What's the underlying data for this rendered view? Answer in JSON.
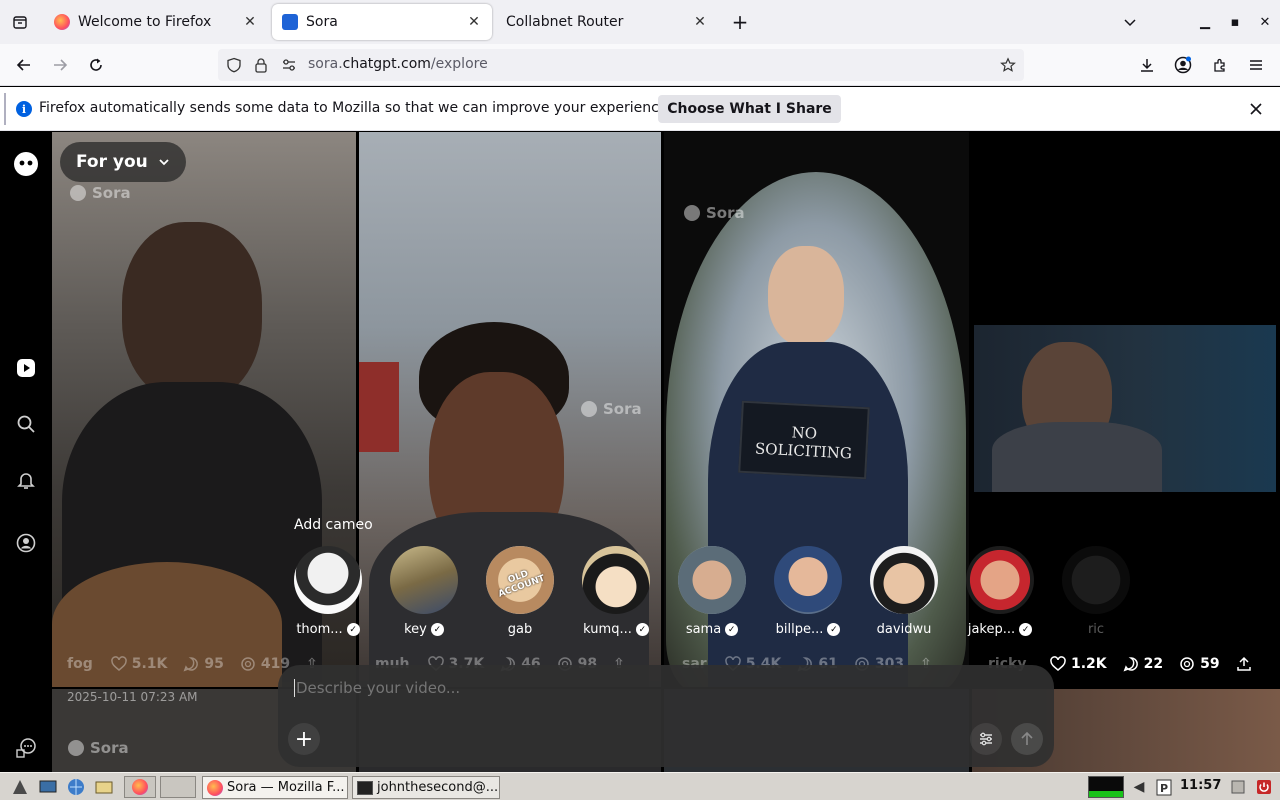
{
  "browser": {
    "tabs": [
      {
        "title": "Welcome to Firefox",
        "active": false
      },
      {
        "title": "Sora",
        "active": true
      },
      {
        "title": "Collabnet Router",
        "active": false
      }
    ],
    "url": {
      "scheme": "",
      "prefix": "sora.",
      "host": "chatgpt.com",
      "path": "/explore"
    },
    "notification": {
      "text": "Firefox automatically sends some data to Mozilla so that we can improve your experience.",
      "button": "Choose What I Share"
    }
  },
  "sora": {
    "feed_selector": "For you",
    "watermark": "Sora",
    "date_label": "2025-10-11 07:23 AM",
    "sign_text": "NO SOLICITING",
    "tiles": [
      {
        "user": "fog",
        "likes": "5.1K",
        "comments": "95",
        "remixes": "419"
      },
      {
        "user": "muh",
        "likes": "3.7K",
        "comments": "46",
        "remixes": "98"
      },
      {
        "user": "sar",
        "likes": "5.4K",
        "comments": "61",
        "remixes": "303"
      },
      {
        "user": "ricky",
        "likes": "1.2K",
        "comments": "22",
        "remixes": "59"
      }
    ],
    "cameo": {
      "title": "Add cameo",
      "people": [
        {
          "name": "thom...",
          "verified": true
        },
        {
          "name": "key",
          "verified": true
        },
        {
          "name": "gab",
          "verified": false,
          "badge": "OLD ACCOUNT"
        },
        {
          "name": "kumq...",
          "verified": true
        },
        {
          "name": "sama",
          "verified": true
        },
        {
          "name": "billpe...",
          "verified": true
        },
        {
          "name": "davidwu",
          "verified": false
        },
        {
          "name": "jakep...",
          "verified": true
        },
        {
          "name": "ric",
          "verified": false
        }
      ]
    },
    "composer": {
      "placeholder": "Describe your video..."
    }
  },
  "taskbar": {
    "tasks": [
      "Sora — Mozilla F...",
      "johnthesecond@..."
    ],
    "clock": "11:57"
  },
  "colors": {
    "firefox_blue": "#0061e0",
    "tab_bg": "#f0f0f4",
    "page_bg": "#000000"
  }
}
